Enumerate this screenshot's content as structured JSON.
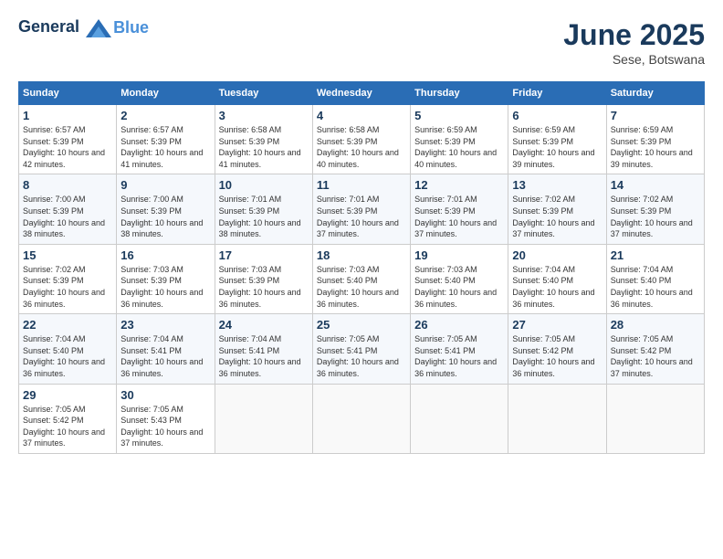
{
  "header": {
    "logo_line1": "General",
    "logo_line2": "Blue",
    "month": "June 2025",
    "location": "Sese, Botswana"
  },
  "weekdays": [
    "Sunday",
    "Monday",
    "Tuesday",
    "Wednesday",
    "Thursday",
    "Friday",
    "Saturday"
  ],
  "weeks": [
    [
      {
        "day": "1",
        "sunrise": "6:57 AM",
        "sunset": "5:39 PM",
        "daylight": "10 hours and 42 minutes."
      },
      {
        "day": "2",
        "sunrise": "6:57 AM",
        "sunset": "5:39 PM",
        "daylight": "10 hours and 41 minutes."
      },
      {
        "day": "3",
        "sunrise": "6:58 AM",
        "sunset": "5:39 PM",
        "daylight": "10 hours and 41 minutes."
      },
      {
        "day": "4",
        "sunrise": "6:58 AM",
        "sunset": "5:39 PM",
        "daylight": "10 hours and 40 minutes."
      },
      {
        "day": "5",
        "sunrise": "6:59 AM",
        "sunset": "5:39 PM",
        "daylight": "10 hours and 40 minutes."
      },
      {
        "day": "6",
        "sunrise": "6:59 AM",
        "sunset": "5:39 PM",
        "daylight": "10 hours and 39 minutes."
      },
      {
        "day": "7",
        "sunrise": "6:59 AM",
        "sunset": "5:39 PM",
        "daylight": "10 hours and 39 minutes."
      }
    ],
    [
      {
        "day": "8",
        "sunrise": "7:00 AM",
        "sunset": "5:39 PM",
        "daylight": "10 hours and 38 minutes."
      },
      {
        "day": "9",
        "sunrise": "7:00 AM",
        "sunset": "5:39 PM",
        "daylight": "10 hours and 38 minutes."
      },
      {
        "day": "10",
        "sunrise": "7:01 AM",
        "sunset": "5:39 PM",
        "daylight": "10 hours and 38 minutes."
      },
      {
        "day": "11",
        "sunrise": "7:01 AM",
        "sunset": "5:39 PM",
        "daylight": "10 hours and 37 minutes."
      },
      {
        "day": "12",
        "sunrise": "7:01 AM",
        "sunset": "5:39 PM",
        "daylight": "10 hours and 37 minutes."
      },
      {
        "day": "13",
        "sunrise": "7:02 AM",
        "sunset": "5:39 PM",
        "daylight": "10 hours and 37 minutes."
      },
      {
        "day": "14",
        "sunrise": "7:02 AM",
        "sunset": "5:39 PM",
        "daylight": "10 hours and 37 minutes."
      }
    ],
    [
      {
        "day": "15",
        "sunrise": "7:02 AM",
        "sunset": "5:39 PM",
        "daylight": "10 hours and 36 minutes."
      },
      {
        "day": "16",
        "sunrise": "7:03 AM",
        "sunset": "5:39 PM",
        "daylight": "10 hours and 36 minutes."
      },
      {
        "day": "17",
        "sunrise": "7:03 AM",
        "sunset": "5:39 PM",
        "daylight": "10 hours and 36 minutes."
      },
      {
        "day": "18",
        "sunrise": "7:03 AM",
        "sunset": "5:40 PM",
        "daylight": "10 hours and 36 minutes."
      },
      {
        "day": "19",
        "sunrise": "7:03 AM",
        "sunset": "5:40 PM",
        "daylight": "10 hours and 36 minutes."
      },
      {
        "day": "20",
        "sunrise": "7:04 AM",
        "sunset": "5:40 PM",
        "daylight": "10 hours and 36 minutes."
      },
      {
        "day": "21",
        "sunrise": "7:04 AM",
        "sunset": "5:40 PM",
        "daylight": "10 hours and 36 minutes."
      }
    ],
    [
      {
        "day": "22",
        "sunrise": "7:04 AM",
        "sunset": "5:40 PM",
        "daylight": "10 hours and 36 minutes."
      },
      {
        "day": "23",
        "sunrise": "7:04 AM",
        "sunset": "5:41 PM",
        "daylight": "10 hours and 36 minutes."
      },
      {
        "day": "24",
        "sunrise": "7:04 AM",
        "sunset": "5:41 PM",
        "daylight": "10 hours and 36 minutes."
      },
      {
        "day": "25",
        "sunrise": "7:05 AM",
        "sunset": "5:41 PM",
        "daylight": "10 hours and 36 minutes."
      },
      {
        "day": "26",
        "sunrise": "7:05 AM",
        "sunset": "5:41 PM",
        "daylight": "10 hours and 36 minutes."
      },
      {
        "day": "27",
        "sunrise": "7:05 AM",
        "sunset": "5:42 PM",
        "daylight": "10 hours and 36 minutes."
      },
      {
        "day": "28",
        "sunrise": "7:05 AM",
        "sunset": "5:42 PM",
        "daylight": "10 hours and 37 minutes."
      }
    ],
    [
      {
        "day": "29",
        "sunrise": "7:05 AM",
        "sunset": "5:42 PM",
        "daylight": "10 hours and 37 minutes."
      },
      {
        "day": "30",
        "sunrise": "7:05 AM",
        "sunset": "5:43 PM",
        "daylight": "10 hours and 37 minutes."
      },
      null,
      null,
      null,
      null,
      null
    ]
  ]
}
